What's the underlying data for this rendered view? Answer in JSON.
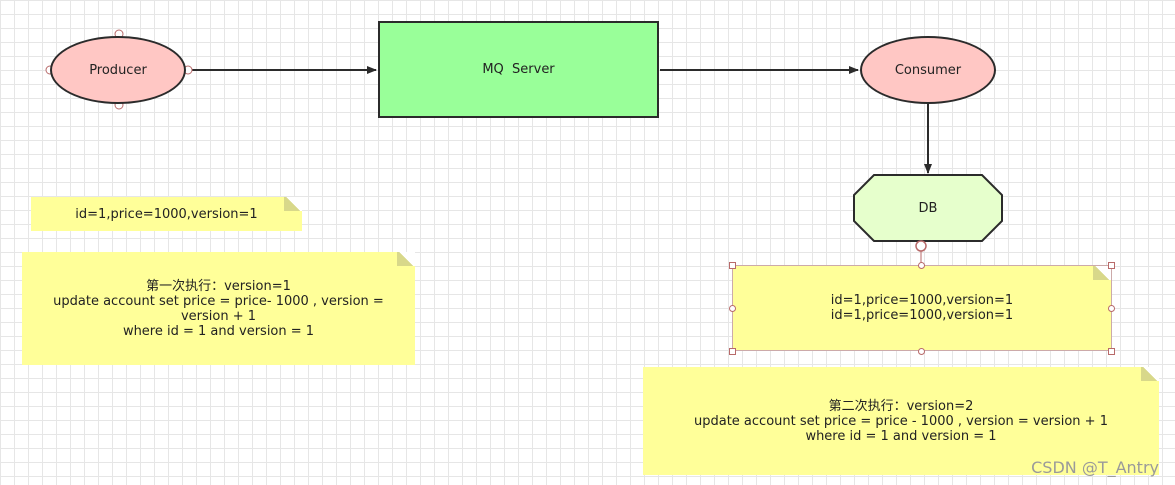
{
  "nodes": {
    "producer": "Producer",
    "mq_server": "MQ  Server",
    "consumer": "Consumer",
    "db": "DB"
  },
  "notes": {
    "initial_state": "id=1,price=1000,version=1",
    "first_execution": {
      "line1": "第一次执行：version=1",
      "line2": "update account set price = price- 1000 , version = version + 1",
      "line3": "where id = 1 and version = 1"
    },
    "db_records": {
      "line1": "id=1,price=1000,version=1",
      "line2": "id=1,price=1000,version=1"
    },
    "second_execution": {
      "line1": "第二次执行：version=2",
      "line2": "update account set price = price - 1000 , version = version + 1",
      "line3": "where id = 1 and version = 1"
    }
  },
  "watermark": "CSDN @T_Antry"
}
